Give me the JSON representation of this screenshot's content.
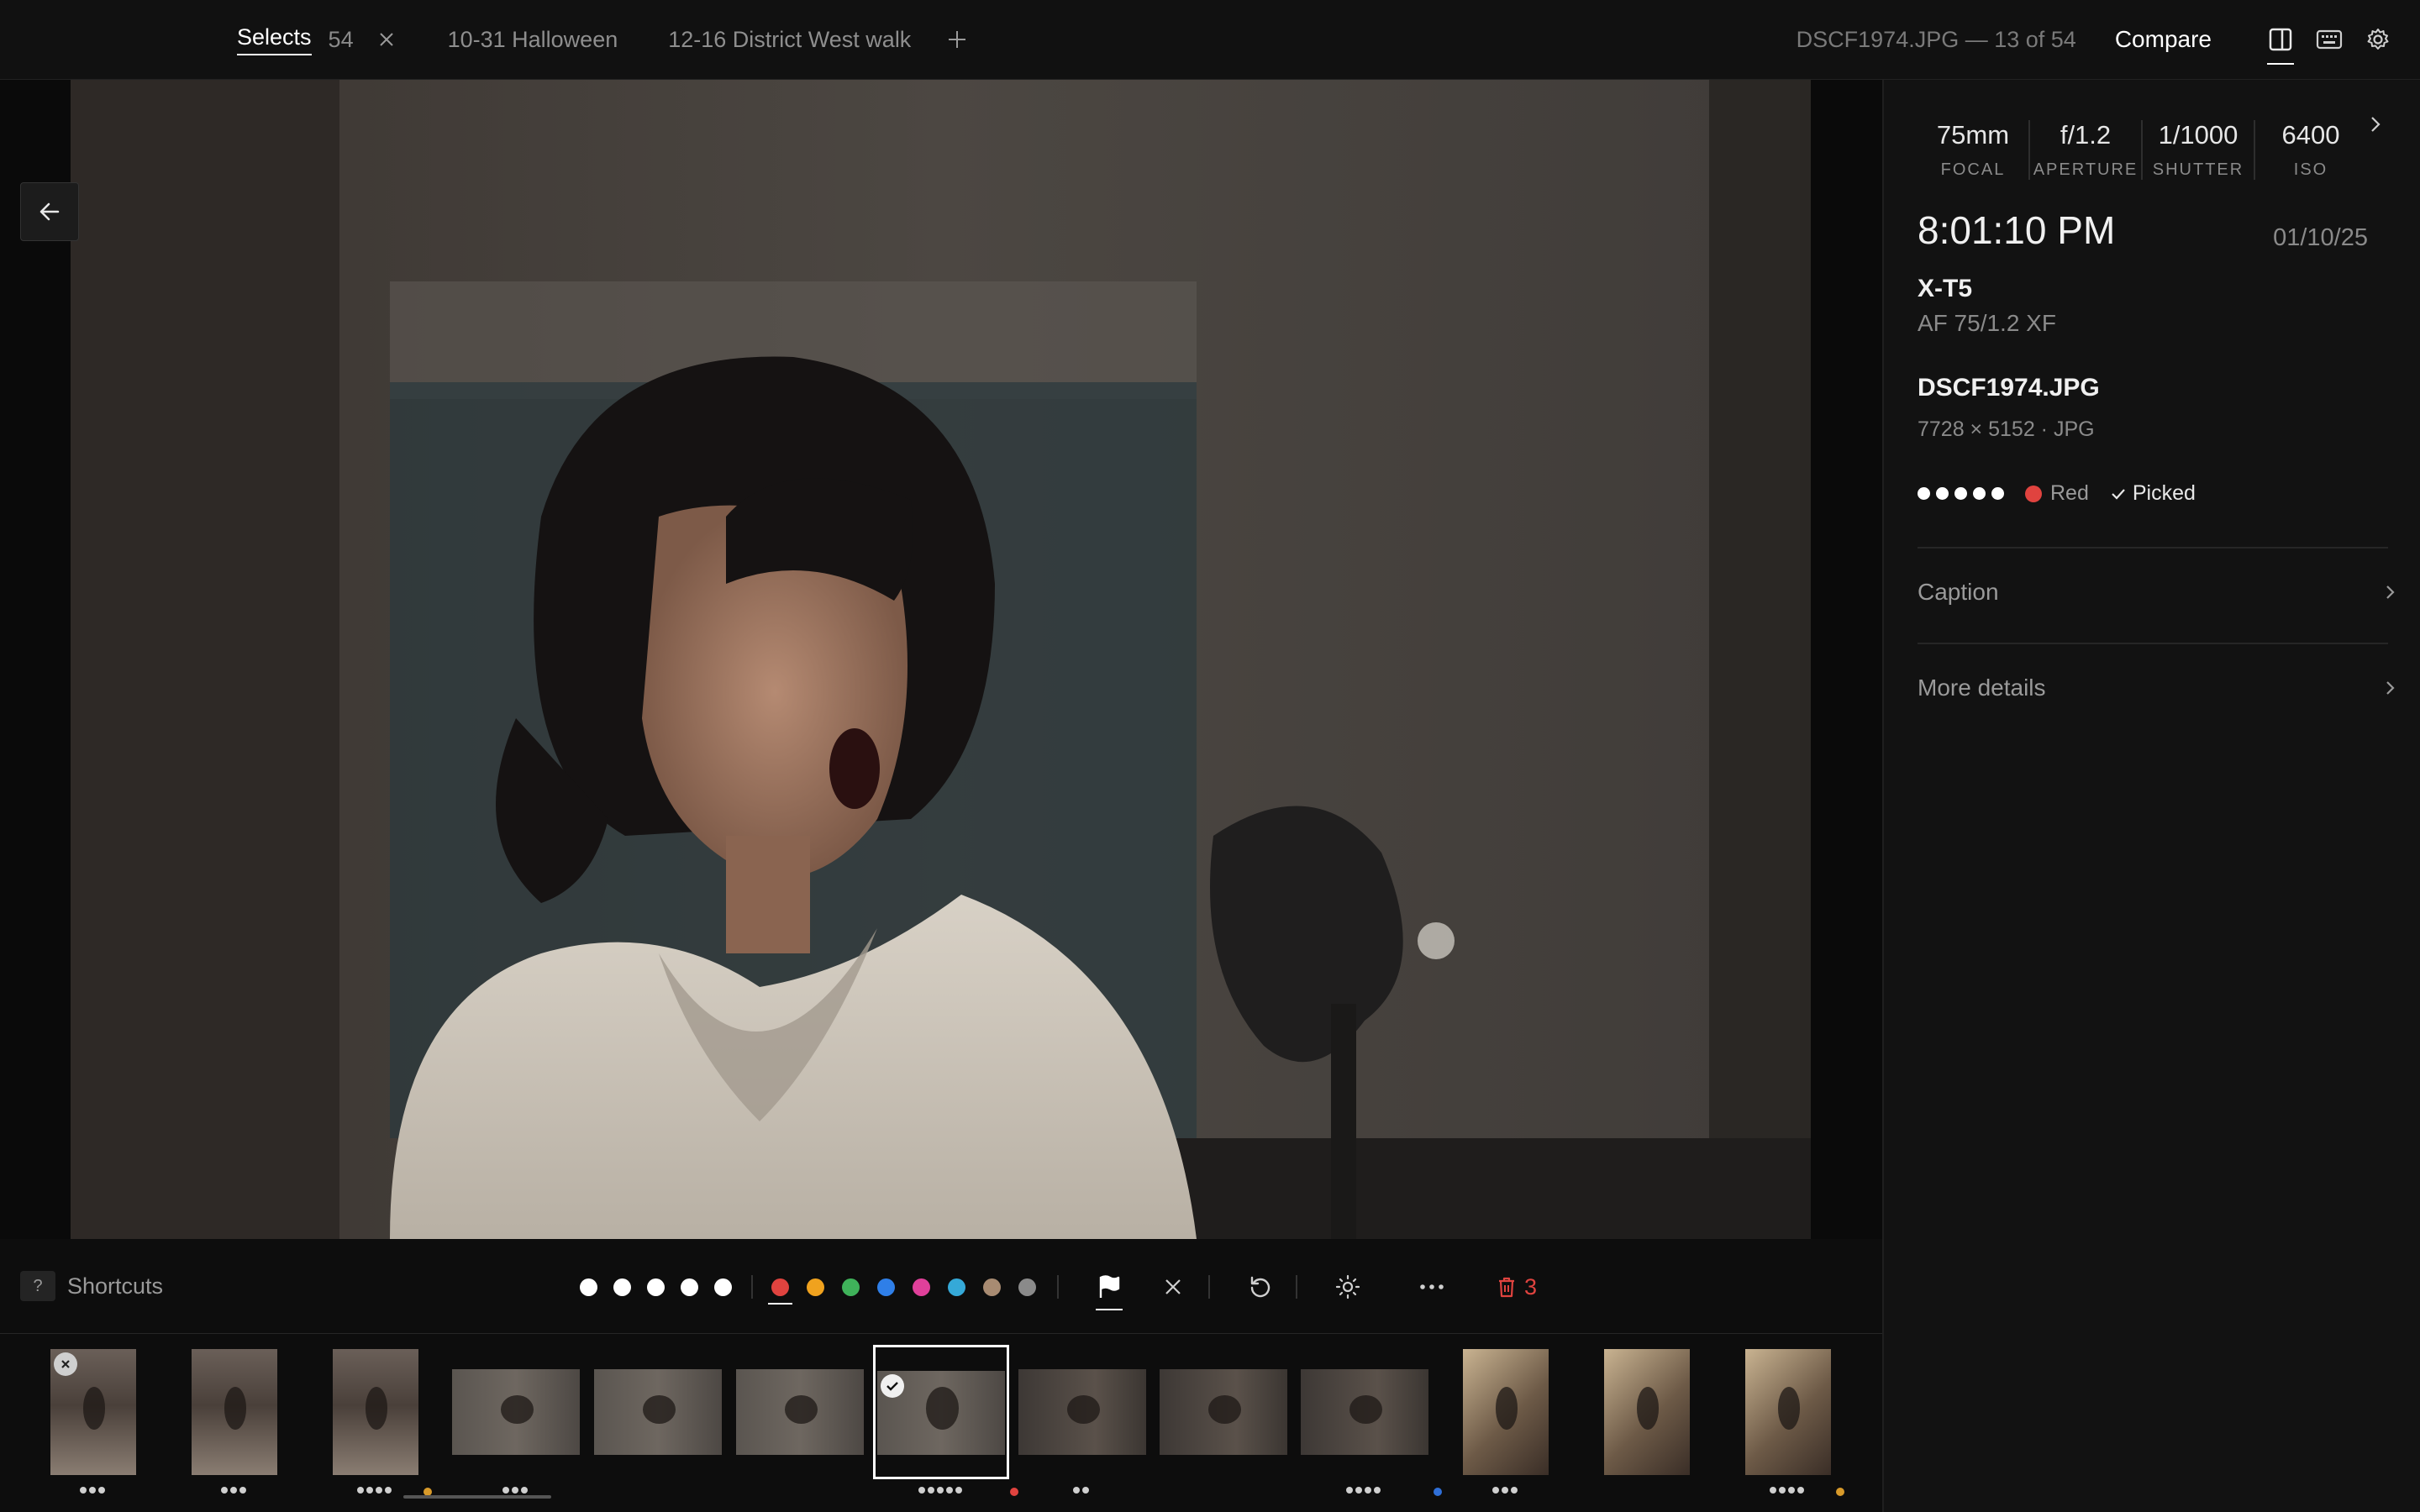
{
  "tabs": [
    {
      "label": "Selects",
      "count": "54"
    },
    {
      "label": "10-31 Halloween"
    },
    {
      "label": "12-16 District West walk"
    }
  ],
  "header": {
    "file_counter": "DSCF1974.JPG — 13 of 54",
    "compare_label": "Compare"
  },
  "toolbar": {
    "shortcuts_key": "?",
    "shortcuts_label": "Shortcuts",
    "rating_max": 5,
    "color_labels": [
      "#e0433f",
      "#f0a21e",
      "#3fb25a",
      "#2f7fe8",
      "#e0409a",
      "#35a9d8",
      "#a88b72",
      "#8a8a8a"
    ],
    "selected_color": "#e0433f",
    "trash_count": "3"
  },
  "exif": [
    {
      "value": "75mm",
      "label": "FOCAL"
    },
    {
      "value": "f/1.2",
      "label": "APERTURE"
    },
    {
      "value": "1/1000",
      "label": "SHUTTER"
    },
    {
      "value": "6400",
      "label": "ISO"
    }
  ],
  "details": {
    "time": "8:01:10 PM",
    "date": "01/10/25",
    "camera": "X-T5",
    "lens": "AF 75/1.2 XF",
    "filename": "DSCF1974.JPG",
    "file_meta": "7728 × 5152 · JPG",
    "rating": 5,
    "color_label": "Red",
    "pick_status": "Picked",
    "sections": [
      "Caption",
      "More details"
    ]
  },
  "filmstrip": {
    "current_index": 6,
    "thumbs": [
      {
        "rating": 3,
        "rejected": true
      },
      {
        "rating": 3
      },
      {
        "rating": 4,
        "color": "#d89a2a"
      },
      {
        "rating": 3
      },
      {
        "rating": 0
      },
      {
        "rating": 0
      },
      {
        "rating": 5,
        "color": "#e0433f",
        "picked": true
      },
      {
        "rating": 2
      },
      {
        "rating": 0
      },
      {
        "rating": 4,
        "color": "#2f6fd8"
      },
      {
        "rating": 3
      },
      {
        "rating": 0
      },
      {
        "rating": 4,
        "color": "#d89a2a"
      }
    ]
  }
}
